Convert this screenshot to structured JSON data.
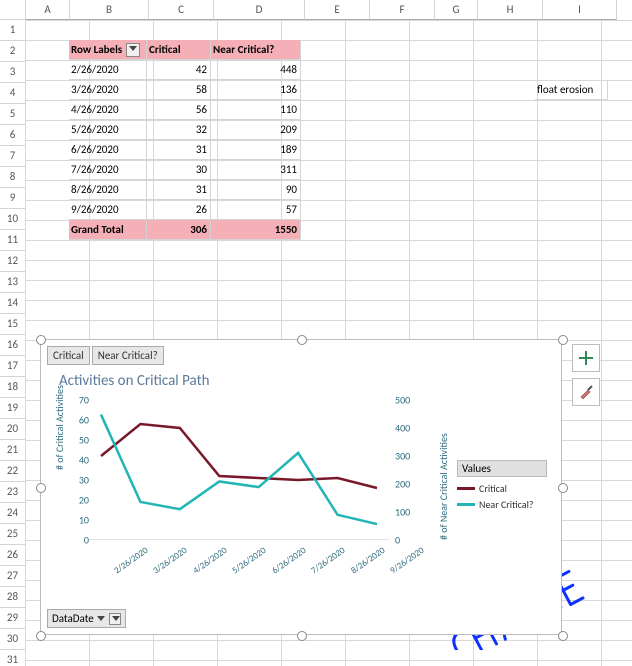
{
  "columns": [
    "A",
    "B",
    "C",
    "D",
    "E",
    "F",
    "G",
    "H",
    "I"
  ],
  "visible_rows": 31,
  "pivot": {
    "header": {
      "row_labels": "Row Labels",
      "col1": "Critical",
      "col2": "Near Critical?"
    },
    "rows": [
      {
        "label": "2/26/2020",
        "critical": 42,
        "near": 448
      },
      {
        "label": "3/26/2020",
        "critical": 58,
        "near": 136
      },
      {
        "label": "4/26/2020",
        "critical": 56,
        "near": 110
      },
      {
        "label": "5/26/2020",
        "critical": 32,
        "near": 209
      },
      {
        "label": "6/26/2020",
        "critical": 31,
        "near": 189
      },
      {
        "label": "7/26/2020",
        "critical": 30,
        "near": 311
      },
      {
        "label": "8/26/2020",
        "critical": 31,
        "near": 90
      },
      {
        "label": "9/26/2020",
        "critical": 26,
        "near": 57
      }
    ],
    "total": {
      "label": "Grand Total",
      "critical": 306,
      "near": 1550
    }
  },
  "stray_text": {
    "float_erosion": "float erosion"
  },
  "chart_buttons": {
    "btn1": "Critical",
    "btn2": "Near Critical?"
  },
  "chart_data": {
    "type": "line",
    "title": "Activities on Critical Path",
    "categories": [
      "2/26/2020",
      "3/26/2020",
      "4/26/2020",
      "5/26/2020",
      "6/26/2020",
      "7/26/2020",
      "8/26/2020",
      "9/26/2020"
    ],
    "series": [
      {
        "name": "Critical",
        "axis": "left",
        "color": "#78192a",
        "values": [
          42,
          58,
          56,
          32,
          31,
          30,
          31,
          26
        ]
      },
      {
        "name": "Near Critical?",
        "axis": "right",
        "color": "#21b5b5",
        "values": [
          448,
          136,
          110,
          209,
          189,
          311,
          90,
          57
        ]
      }
    ],
    "y_left": {
      "label": "# of Critical Activities",
      "ticks": [
        0,
        10,
        20,
        30,
        40,
        50,
        60,
        70
      ],
      "min": 0,
      "max": 70
    },
    "y_right": {
      "label": "# of Near  Critical Activities",
      "ticks": [
        0,
        100,
        200,
        300,
        400,
        500
      ],
      "min": 0,
      "max": 500
    },
    "legend_title": "Values",
    "slicer": "DataDate"
  },
  "ink": {
    "arrow_hint": "↖",
    "change": "CHANGE"
  }
}
